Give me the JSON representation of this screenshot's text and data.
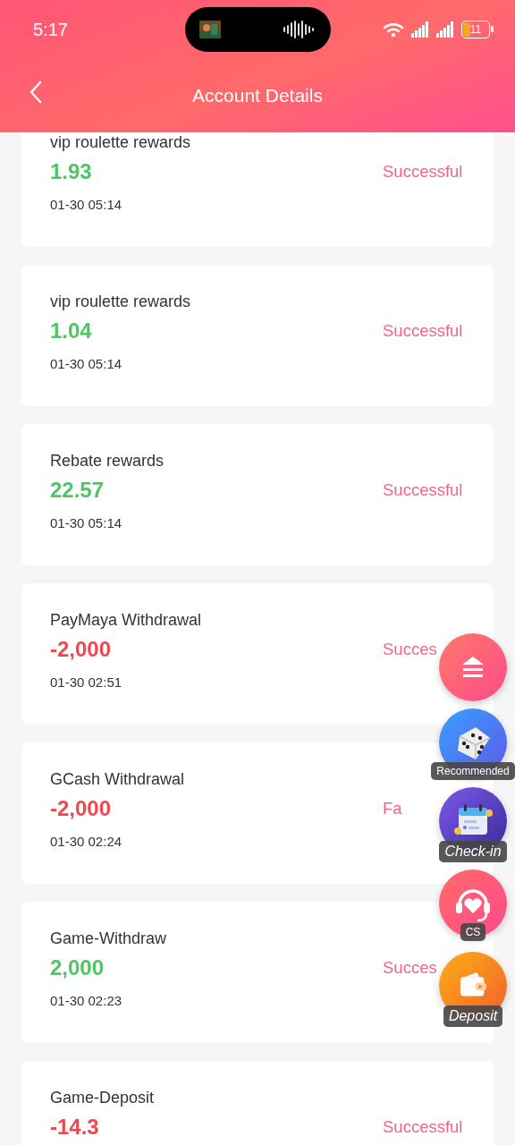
{
  "status_bar": {
    "time": "5:17",
    "battery": "11"
  },
  "header": {
    "title": "Account Details"
  },
  "records": [
    {
      "title": "vip roulette rewards",
      "amount": "1.93",
      "kind": "credit",
      "time": "01-30 05:14",
      "status": "Successful"
    },
    {
      "title": "vip roulette rewards",
      "amount": "1.04",
      "kind": "credit",
      "time": "01-30 05:14",
      "status": "Successful"
    },
    {
      "title": "Rebate rewards",
      "amount": "22.57",
      "kind": "credit",
      "time": "01-30 05:14",
      "status": "Successful"
    },
    {
      "title": "PayMaya Withdrawal",
      "amount": "-2,000",
      "kind": "debit",
      "time": "01-30 02:51",
      "status": "Succes"
    },
    {
      "title": "GCash Withdrawal",
      "amount": "-2,000",
      "kind": "debit",
      "time": "01-30 02:24",
      "status": "Fa"
    },
    {
      "title": "Game-Withdraw",
      "amount": "2,000",
      "kind": "credit",
      "time": "01-30 02:23",
      "status": "Succes"
    },
    {
      "title": "Game-Deposit",
      "amount": "-14.3",
      "kind": "debit",
      "status": "Successful"
    }
  ],
  "floating_buttons": [
    {
      "kind": "top"
    },
    {
      "kind": "dice",
      "label": "Recommended"
    },
    {
      "kind": "calendar",
      "label": "Check-in"
    },
    {
      "kind": "support",
      "label": "CS"
    },
    {
      "kind": "wallet",
      "label": "Deposit"
    }
  ]
}
